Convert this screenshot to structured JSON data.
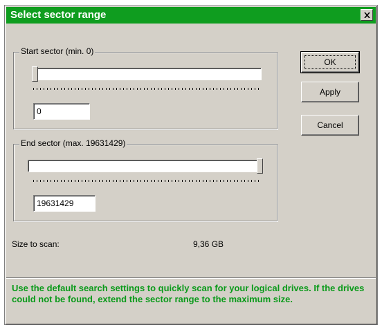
{
  "window": {
    "title": "Select sector range",
    "titlebar_color": "#0f9d1f",
    "close_icon": "close-icon"
  },
  "start_group": {
    "legend": "Start sector (min. 0)",
    "value": "0",
    "slider_position_fraction": 0.0
  },
  "end_group": {
    "legend": "End sector (max. 19631429)",
    "value": "19631429",
    "slider_position_fraction": 1.0
  },
  "buttons": {
    "ok": "OK",
    "apply": "Apply",
    "cancel": "Cancel"
  },
  "summary": {
    "label": "Size to scan:",
    "value": "9,36 GB"
  },
  "info": {
    "text": "Use the default search settings to quickly scan for your logical drives. If the drives could not be found, extend the sector range to the maximum size.",
    "color": "#0a9a1a"
  }
}
